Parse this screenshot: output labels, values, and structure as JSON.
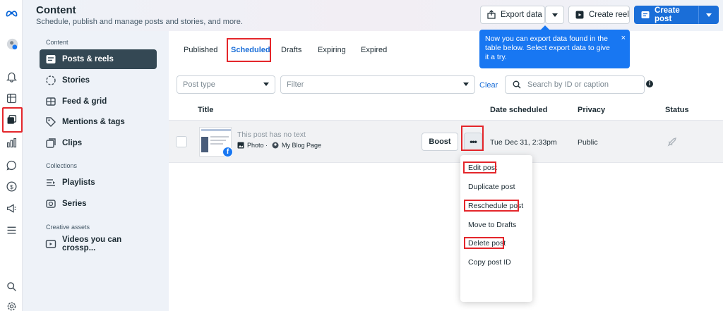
{
  "header": {
    "title": "Content",
    "subtitle": "Schedule, publish and manage posts and stories, and more.",
    "export_label": "Export data",
    "create_reel_label": "Create reel",
    "create_post_label": "Create post"
  },
  "tooltip": {
    "text": "Now you can export data found in the table below. Select export data to give it a try.",
    "close": "×"
  },
  "sidebar": {
    "section_content": "Content",
    "items": [
      {
        "label": "Posts & reels"
      },
      {
        "label": "Stories"
      },
      {
        "label": "Feed & grid"
      },
      {
        "label": "Mentions & tags"
      },
      {
        "label": "Clips"
      }
    ],
    "section_collections": "Collections",
    "collections": [
      {
        "label": "Playlists"
      },
      {
        "label": "Series"
      }
    ],
    "section_creative": "Creative assets",
    "creative": [
      {
        "label": "Videos you can crossp..."
      }
    ]
  },
  "tabs": [
    {
      "label": "Published"
    },
    {
      "label": "Scheduled"
    },
    {
      "label": "Drafts"
    },
    {
      "label": "Expiring"
    },
    {
      "label": "Expired"
    }
  ],
  "filters": {
    "post_type": "Post type",
    "filter": "Filter",
    "clear": "Clear",
    "search_placeholder": "Search by ID or caption"
  },
  "table": {
    "columns": [
      "Title",
      "Date scheduled",
      "Privacy",
      "Status"
    ],
    "rows": [
      {
        "text": "This post has no text",
        "type": "Photo ·",
        "page": "My Blog Page",
        "boost": "Boost",
        "more": "•••",
        "date": "Tue Dec 31, 2:33pm",
        "privacy": "Public"
      }
    ]
  },
  "menu": {
    "items": [
      "Edit post",
      "Duplicate post",
      "Reschedule post",
      "Move to Drafts",
      "Delete post",
      "Copy post ID"
    ]
  },
  "colors": {
    "accent": "#1a6ed8",
    "highlight": "#e4262b",
    "tooltip": "#1877f2",
    "sidebar_active": "#344854"
  }
}
